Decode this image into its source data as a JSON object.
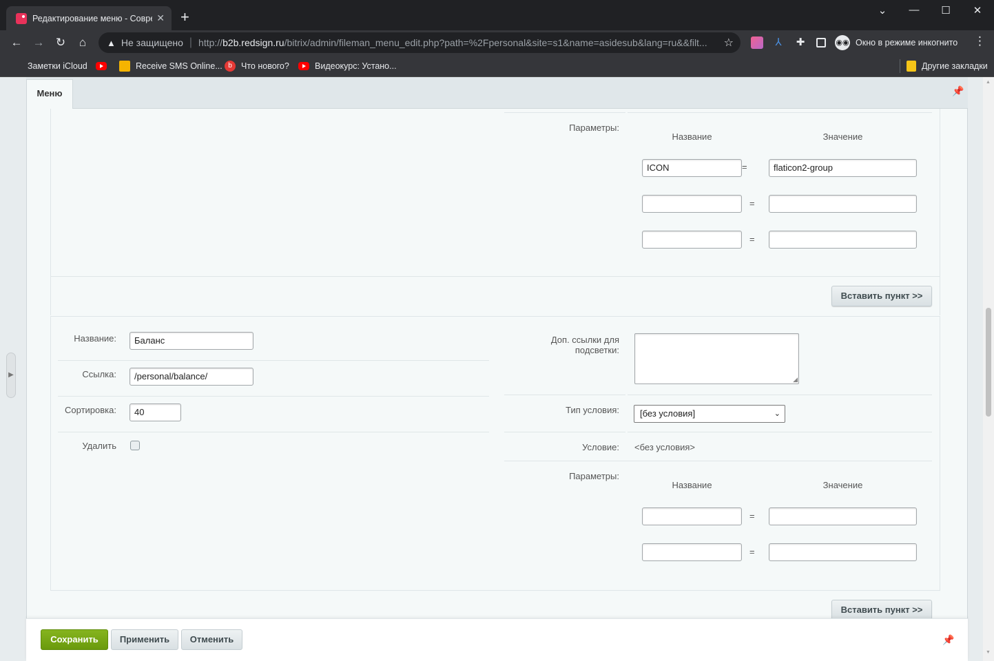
{
  "browser": {
    "tab_title": "Редактирование меню - Совре",
    "tab_close": "✕",
    "new_tab": "+",
    "window_controls": [
      "⌄",
      "—",
      "☐",
      "✕"
    ],
    "security_label": "Не защищено",
    "url_prefix": "http://",
    "url_host": "b2b.redsign.ru",
    "url_path": "/bitrix/admin/fileman_menu_edit.php?path=%2Fpersonal&site=s1&name=asidesub&lang=ru&&filt...",
    "incognito_label": "Окно в режиме инкогнито",
    "bookmarks": [
      "Заметки iCloud",
      "",
      "Receive SMS Online...",
      "Что нового?",
      "Видеокурс: Устано..."
    ],
    "other_bookmarks": "Другие закладки"
  },
  "page": {
    "tab_label": "Меню"
  },
  "item1": {
    "params_label": "Параметры:",
    "col_name": "Название",
    "col_value": "Значение",
    "params": [
      {
        "name": "ICON",
        "value": "flaticon2-group"
      },
      {
        "name": "",
        "value": ""
      },
      {
        "name": "",
        "value": ""
      }
    ],
    "eq": "=",
    "insert_button": "Вставить пункт >>"
  },
  "item2": {
    "name_label": "Название:",
    "name_value": "Баланс",
    "link_label": "Ссылка:",
    "link_value": "/personal/balance/",
    "sort_label": "Сортировка:",
    "sort_value": "40",
    "delete_label": "Удалить",
    "extra_links_label_1": "Доп. ссылки для",
    "extra_links_label_2": "подсветки:",
    "extra_links_value": "",
    "cond_type_label": "Тип условия:",
    "cond_type_value": "[без условия]",
    "condition_label": "Условие:",
    "condition_value": "<без условия>",
    "params_label": "Параметры:",
    "col_name": "Название",
    "col_value": "Значение",
    "params": [
      {
        "name": "",
        "value": ""
      },
      {
        "name": "",
        "value": ""
      }
    ],
    "eq": "=",
    "insert_button": "Вставить пункт >>"
  },
  "footer": {
    "save": "Сохранить",
    "apply": "Применить",
    "cancel": "Отменить"
  },
  "colors": {
    "save_green": "#7aa817",
    "page_bg": "#e7ecee",
    "panel_bg": "#f5f9f9"
  }
}
